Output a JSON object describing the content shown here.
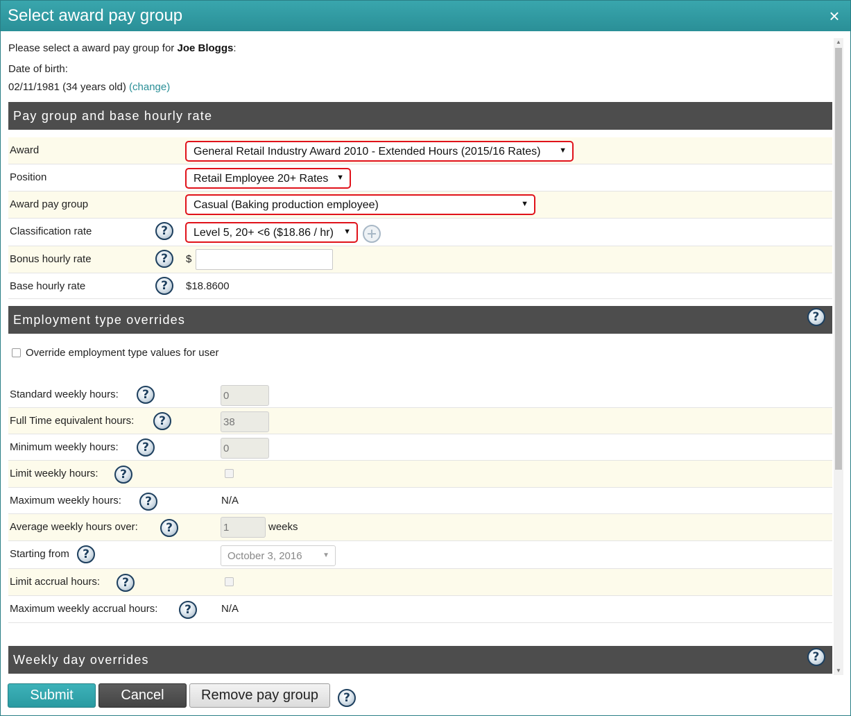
{
  "dialog": {
    "title": "Select award pay group",
    "close_icon": "×"
  },
  "intro": {
    "prompt_prefix": "Please select a award pay group for ",
    "employee_name": "Joe Bloggs",
    "prompt_suffix": ":",
    "dob_label": "Date of birth:",
    "dob_value": "02/11/1981 (34 years old)",
    "change_link": "(change)"
  },
  "pay_group_section": {
    "heading": "Pay group and base hourly rate",
    "award": {
      "label": "Award",
      "value": "General Retail Industry Award 2010 - Extended Hours (2015/16 Rates)"
    },
    "position": {
      "label": "Position",
      "value": "Retail Employee 20+ Rates"
    },
    "award_pay_group": {
      "label": "Award pay group",
      "value": "Casual (Baking production employee)"
    },
    "classification_rate": {
      "label": "Classification rate",
      "value": "Level 5, 20+ <6 ($18.86 / hr)"
    },
    "bonus_hourly_rate": {
      "label": "Bonus hourly rate",
      "currency": "$",
      "value": ""
    },
    "base_hourly_rate": {
      "label": "Base hourly rate",
      "value": "$18.8600"
    }
  },
  "employment_section": {
    "heading": "Employment type overrides",
    "override_checkbox_label": "Override employment type values for user",
    "standard_weekly_hours": {
      "label": "Standard weekly hours:",
      "value": "0"
    },
    "full_time_equivalent_hours": {
      "label": "Full Time equivalent hours:",
      "value": "38"
    },
    "minimum_weekly_hours": {
      "label": "Minimum weekly hours:",
      "value": "0"
    },
    "limit_weekly_hours": {
      "label": "Limit weekly hours:"
    },
    "maximum_weekly_hours": {
      "label": "Maximum weekly hours:",
      "value": "N/A"
    },
    "average_weekly_hours_over": {
      "label": "Average weekly hours over:",
      "value": "1",
      "unit": "weeks"
    },
    "starting_from": {
      "label": "Starting from",
      "value": "October 3, 2016"
    },
    "limit_accrual_hours": {
      "label": "Limit accrual hours:"
    },
    "maximum_weekly_accrual_hours": {
      "label": "Maximum weekly accrual hours:",
      "value": "N/A"
    }
  },
  "weekly_day_section": {
    "heading": "Weekly day overrides"
  },
  "footer": {
    "submit": "Submit",
    "cancel": "Cancel",
    "remove": "Remove pay group"
  },
  "icons": {
    "help": "?",
    "caret": "▼"
  },
  "colors": {
    "title_bar": "#2a8f97",
    "section_header": "#4d4d4d",
    "highlight_border": "#e0121a",
    "alt_row": "#fdfbeb",
    "link": "#2a8f97"
  }
}
